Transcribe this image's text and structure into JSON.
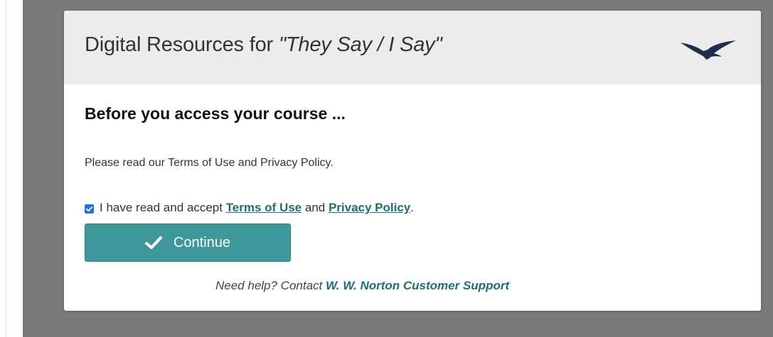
{
  "modal": {
    "title_prefix": "Digital Resources for ",
    "title_book": "\"They Say / I Say\"",
    "logo_icon": "norton-seagull-logo-icon",
    "heading": "Before you access your course ...",
    "note": "Please read our Terms of Use and Privacy Policy.",
    "accept": {
      "checked": true,
      "prefix": "I have read and accept ",
      "terms_link": "Terms of Use",
      "middle": " and ",
      "privacy_link": "Privacy Policy",
      "suffix": "."
    },
    "continue_button": {
      "label": "Continue",
      "icon": "checkmark-icon"
    },
    "help": {
      "prefix": "Need help? Contact ",
      "link": "W. W. Norton Customer Support"
    }
  },
  "colors": {
    "overlay": "#7a7a7a",
    "header_bg": "#ececec",
    "accent": "#3e9798",
    "link": "#1f6e74",
    "logo": "#1c2f4a"
  }
}
